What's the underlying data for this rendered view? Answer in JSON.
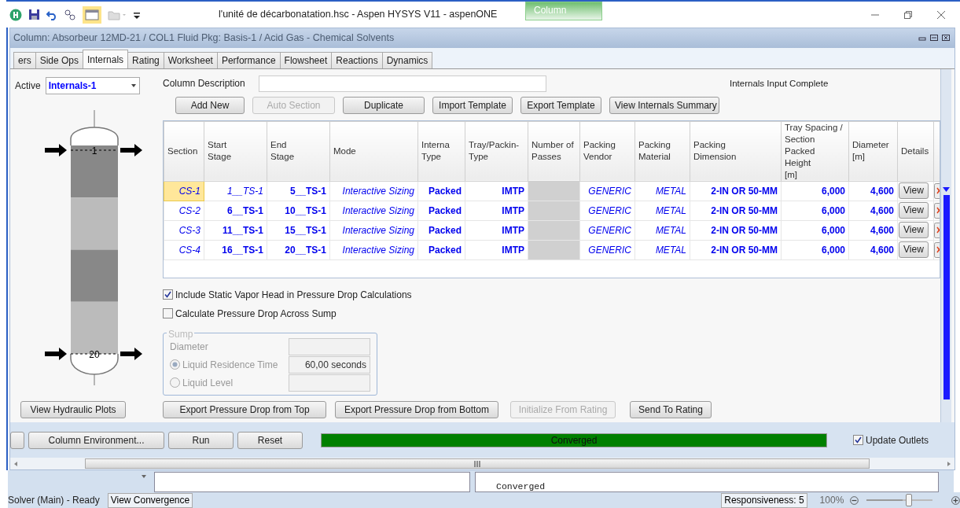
{
  "app": {
    "title": "l'unité de décarbonatation.hsc - Aspen HYSYS V11 - aspenONE",
    "context_tab": "Column"
  },
  "window": {
    "title": "Column: Absorbeur 12MD-21 / COL1  Fluid Pkg: Basis-1 / Acid Gas - Chemical Solvents"
  },
  "tabs": [
    {
      "label": "ers",
      "selected": false
    },
    {
      "label": "Side Ops",
      "selected": false
    },
    {
      "label": "Internals",
      "selected": true
    },
    {
      "label": "Rating",
      "selected": false
    },
    {
      "label": "Worksheet",
      "selected": false
    },
    {
      "label": "Performance",
      "selected": false
    },
    {
      "label": "Flowsheet",
      "selected": false
    },
    {
      "label": "Reactions",
      "selected": false
    },
    {
      "label": "Dynamics",
      "selected": false
    }
  ],
  "active": {
    "label": "Active",
    "value": "Internals-1"
  },
  "column_diagram": {
    "top_stage": "1",
    "bottom_stage": "20"
  },
  "column_description": {
    "label": "Column Description"
  },
  "status_text": "Internals Input Complete",
  "toolbar": [
    {
      "label": "Add New",
      "disabled": false
    },
    {
      "label": "Auto Section",
      "disabled": true
    },
    {
      "label": "Duplicate",
      "disabled": false
    },
    {
      "label": "Import Template",
      "disabled": false
    },
    {
      "label": "Export Template",
      "disabled": false
    },
    {
      "label": "View Internals Summary",
      "disabled": false
    }
  ],
  "table": {
    "columns": [
      "Section",
      "Start\nStage",
      "End\nStage",
      "Mode",
      "Interna\nType",
      "Tray/Packin-\nType",
      "Number of\nPasses",
      "Packing\nVendor",
      "Packing\nMaterial",
      "Packing\nDimension",
      "Tray Spacing /\nSection Packed\nHeight\n[m]",
      "Diameter\n[m]",
      "Details"
    ],
    "rows": [
      {
        "selected": true,
        "details": "View",
        "cells": [
          {
            "text": "CS-1",
            "kind": "italic"
          },
          {
            "text": "1__TS-1",
            "kind": "italic"
          },
          {
            "text": "5__TS-1",
            "kind": "bold"
          },
          {
            "text": "Interactive Sizing",
            "kind": "italic"
          },
          {
            "text": "Packed",
            "kind": "bold"
          },
          {
            "text": "IMTP",
            "kind": "bold"
          },
          {
            "kind": "disabled"
          },
          {
            "text": "GENERIC",
            "kind": "italic"
          },
          {
            "text": "METAL",
            "kind": "italic"
          },
          {
            "text": "2-IN OR 50-MM",
            "kind": "bold"
          },
          {
            "text": "6,000",
            "kind": "bold"
          },
          {
            "text": "4,600",
            "kind": "bold"
          }
        ]
      },
      {
        "selected": false,
        "details": "View",
        "cells": [
          {
            "text": "CS-2",
            "kind": "italic"
          },
          {
            "text": "6__TS-1",
            "kind": "bold"
          },
          {
            "text": "10__TS-1",
            "kind": "bold"
          },
          {
            "text": "Interactive Sizing",
            "kind": "italic"
          },
          {
            "text": "Packed",
            "kind": "bold"
          },
          {
            "text": "IMTP",
            "kind": "bold"
          },
          {
            "kind": "disabled"
          },
          {
            "text": "GENERIC",
            "kind": "italic"
          },
          {
            "text": "METAL",
            "kind": "italic"
          },
          {
            "text": "2-IN OR 50-MM",
            "kind": "bold"
          },
          {
            "text": "6,000",
            "kind": "bold"
          },
          {
            "text": "4,600",
            "kind": "bold"
          }
        ]
      },
      {
        "selected": false,
        "details": "View",
        "cells": [
          {
            "text": "CS-3",
            "kind": "italic"
          },
          {
            "text": "11__TS-1",
            "kind": "bold"
          },
          {
            "text": "15__TS-1",
            "kind": "bold"
          },
          {
            "text": "Interactive Sizing",
            "kind": "italic"
          },
          {
            "text": "Packed",
            "kind": "bold"
          },
          {
            "text": "IMTP",
            "kind": "bold"
          },
          {
            "kind": "disabled"
          },
          {
            "text": "GENERIC",
            "kind": "italic"
          },
          {
            "text": "METAL",
            "kind": "italic"
          },
          {
            "text": "2-IN OR 50-MM",
            "kind": "bold"
          },
          {
            "text": "6,000",
            "kind": "bold"
          },
          {
            "text": "4,600",
            "kind": "bold"
          }
        ]
      },
      {
        "selected": false,
        "details": "View",
        "cells": [
          {
            "text": "CS-4",
            "kind": "italic"
          },
          {
            "text": "16__TS-1",
            "kind": "bold"
          },
          {
            "text": "20__TS-1",
            "kind": "bold"
          },
          {
            "text": "Interactive Sizing",
            "kind": "italic"
          },
          {
            "text": "Packed",
            "kind": "bold"
          },
          {
            "text": "IMTP",
            "kind": "bold"
          },
          {
            "kind": "disabled"
          },
          {
            "text": "GENERIC",
            "kind": "italic"
          },
          {
            "text": "METAL",
            "kind": "italic"
          },
          {
            "text": "2-IN OR 50-MM",
            "kind": "bold"
          },
          {
            "text": "6,000",
            "kind": "bold"
          },
          {
            "text": "4,600",
            "kind": "bold"
          }
        ]
      }
    ]
  },
  "options": [
    {
      "label": "Include Static Vapor Head in Pressure Drop Calculations",
      "checked": true
    },
    {
      "label": "Calculate Pressure Drop Across Sump",
      "checked": false
    }
  ],
  "sump": {
    "title": "Sump",
    "disabled": true,
    "fields": [
      {
        "label": "Diameter",
        "kind": "plain"
      },
      {
        "label": "Liquid Residence Time",
        "kind": "radio",
        "selected": true,
        "value": "60,00 seconds"
      },
      {
        "label": "Liquid Level",
        "kind": "radio",
        "selected": false
      }
    ]
  },
  "hydraulic_button": "View Hydraulic Plots",
  "action_buttons": [
    {
      "label": "Export Pressure Drop from Top",
      "disabled": false
    },
    {
      "label": "Export Pressure Drop from Bottom",
      "disabled": false
    },
    {
      "label": "Initialize From Rating",
      "disabled": true
    },
    {
      "label": "Send To Rating",
      "disabled": false
    }
  ],
  "footer": {
    "buttons": [
      "Column Environment...",
      "Run",
      "Reset"
    ],
    "progress": {
      "text": "Converged",
      "level": 1
    },
    "update_outlets": {
      "label": "Update Outlets",
      "checked": true
    }
  },
  "messages": [
    "Converged"
  ],
  "status_bar": {
    "solver": "Solver (Main) - Ready",
    "view_convergence": "View Convergence",
    "responsiveness": "Responsiveness: 5",
    "zoom": "100%",
    "zoom_slider": {
      "level": 0.55
    }
  }
}
